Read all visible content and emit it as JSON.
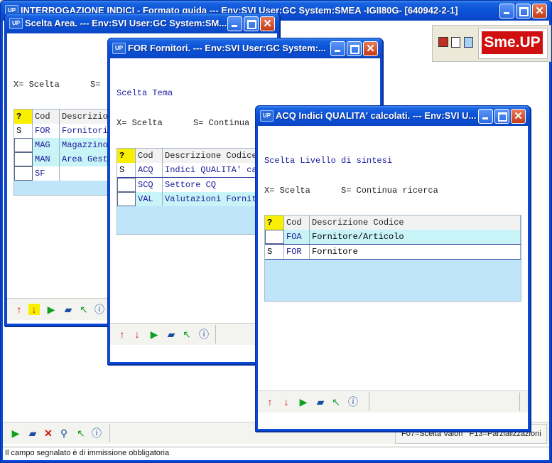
{
  "main_window": {
    "title": "INTERROGAZIONE INDICI - Formato guida --- Env:SVI User:GC System:SMEA -IGII80G- [640942-2-1]",
    "logo_text": "Sme.UP",
    "fkeys": "F07=Scelta Valori   F13=Parzializzazioni",
    "status": "Il campo segnalato è di immissione obbligatoria"
  },
  "win_area": {
    "title": "Scelta Area. --- Env:SVI User:GC System:SM...",
    "legend_x": "X= Scelta",
    "legend_s": "S=",
    "col_q": "?",
    "col_cod": "Cod",
    "col_desc": "Descrizione",
    "rows": [
      {
        "sel": "S",
        "cod": "FOR",
        "desc": "Fornitori"
      },
      {
        "sel": "",
        "cod": "MAG",
        "desc": "Magazzino"
      },
      {
        "sel": "",
        "cod": "MAN",
        "desc": "Area Gestione"
      },
      {
        "sel": "",
        "cod": "SF",
        "desc": ""
      }
    ]
  },
  "win_for": {
    "title": "FOR Fornitori. --- Env:SVI User:GC System:...",
    "heading": "Scelta Tema",
    "legend_x": "X= Scelta",
    "legend_s": "S= Continua ricerca",
    "col_q": "?",
    "col_cod": "Cod",
    "col_desc": "Descrizione Codice",
    "rows": [
      {
        "sel": "S",
        "cod": "ACQ",
        "desc": "Indici QUALITA' calcolati"
      },
      {
        "sel": "",
        "cod": "SCQ",
        "desc": "Settore CQ"
      },
      {
        "sel": "",
        "cod": "VAL",
        "desc": "Valutazioni Fornitori"
      }
    ]
  },
  "win_acq": {
    "title": "ACQ Indici QUALITA' calcolati. --- Env:SVI U...",
    "heading": "Scelta Livello di sintesi",
    "legend_x": "X= Scelta",
    "legend_s": "S= Continua ricerca",
    "col_q": "?",
    "col_cod": "Cod",
    "col_desc": "Descrizione Codice",
    "rows": [
      {
        "sel": "",
        "cod": "FOA",
        "desc": "Fornitore/Articolo"
      },
      {
        "sel": "S",
        "cod": "FOR",
        "desc": "Fornitore"
      }
    ]
  },
  "icons": {
    "up": "arrow-up-icon",
    "down": "arrow-down-icon",
    "run": "play-icon",
    "eraser": "eraser-icon",
    "back": "return-icon",
    "info": "info-icon",
    "cancel": "close-x-icon",
    "search": "magnifier-icon"
  },
  "colors": {
    "titlebar": "#0a4bd0",
    "grid_row": "#c8f4f8",
    "grid_bg": "#bfe5fa",
    "help_cell": "#f8f000",
    "code_text": "#1a1a9a",
    "logo_red": "#d01010"
  }
}
